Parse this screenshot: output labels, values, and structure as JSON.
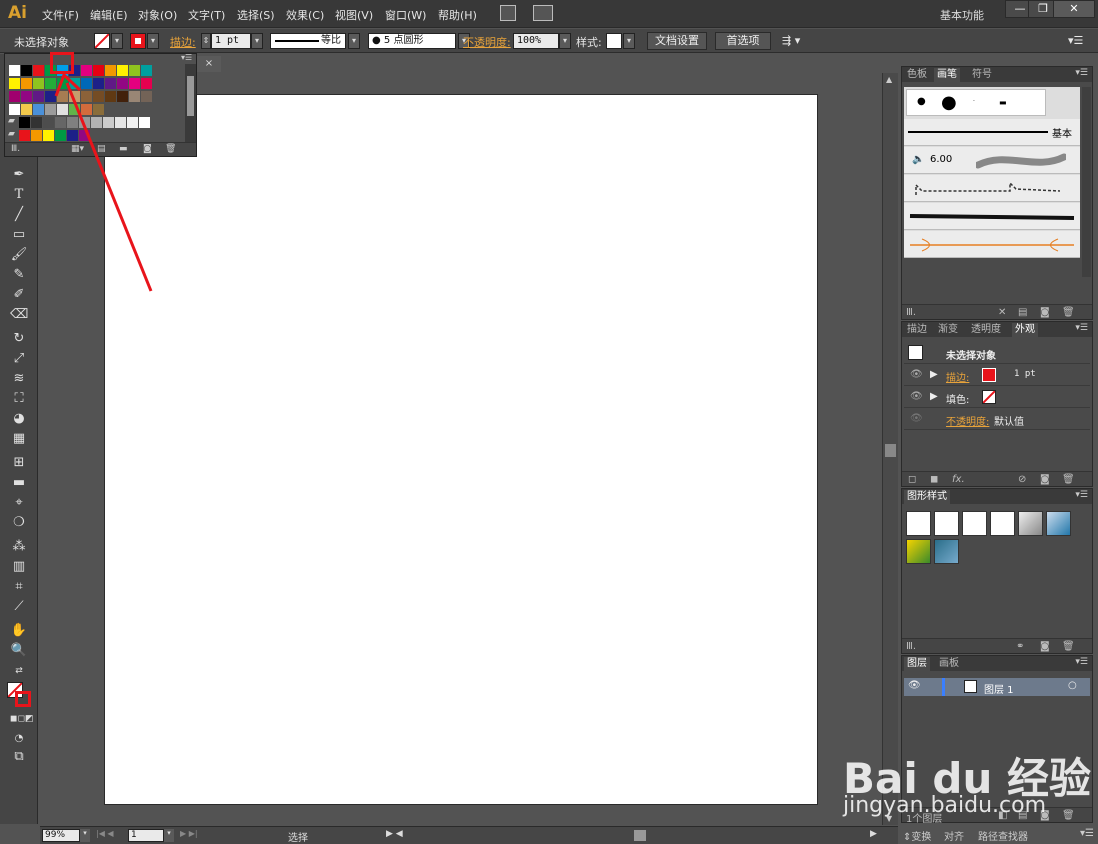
{
  "app": {
    "logo": "Ai"
  },
  "menu": [
    "文件(F)",
    "编辑(E)",
    "对象(O)",
    "文字(T)",
    "选择(S)",
    "效果(C)",
    "视图(V)",
    "窗口(W)",
    "帮助(H)"
  ],
  "workspace": "基本功能",
  "window_buttons": {
    "minimize": "—",
    "restore": "❐",
    "close": "✕"
  },
  "controlbar": {
    "selection_status": "未选择对象",
    "stroke_label": "描边:",
    "stroke_weight": "1 pt",
    "profile_label": "等比",
    "brush_label": "5 点圆形",
    "opacity_label": "不透明度:",
    "opacity_value": "100%",
    "style_label": "样式:",
    "doc_setup": "文档设置",
    "preferences": "首选项"
  },
  "doc_tab_close": "×",
  "colors": {
    "stroke_accent": "#e8141b",
    "label_orange": "#e8a33a",
    "panel_bg": "#4a4a4a",
    "canvas_bg": "#535353"
  },
  "swatches": {
    "row1": [
      "#ffffff",
      "#000000",
      "#e8141b",
      "#009a44",
      "#00a0e9",
      "#1d2088",
      "#e4007f",
      "#e60012",
      "#f39800",
      "#fff100",
      "#8fc31f",
      "#00a0a0"
    ],
    "row2": [
      "#fff100",
      "#f39800",
      "#8fc31f",
      "#22ac38",
      "#009944",
      "#00a29a",
      "#0068b7",
      "#1d2088",
      "#601986",
      "#920783",
      "#e4007f",
      "#e5004f"
    ],
    "row3": [
      "#a0006e",
      "#920783",
      "#601986",
      "#1d2088",
      "#a67c52",
      "#c69c6d",
      "#8c6239",
      "#754c24",
      "#603913",
      "#42210b",
      "#998675",
      "#736357"
    ],
    "row4": [
      "#ffffff",
      "#f2c94c",
      "#4a90d9",
      "#9b9b9b",
      "#e0e0e0",
      "#62b34a",
      "#d36b3c",
      "#8a6d3b"
    ],
    "row5": [
      "#000000",
      "#333333",
      "#4d4d4d",
      "#666666",
      "#808080",
      "#999999",
      "#b3b3b3",
      "#cccccc",
      "#e6e6e6",
      "#f2f2f2",
      "#ffffff"
    ],
    "row6": [
      "#e8141b",
      "#f39800",
      "#fff100",
      "#009944",
      "#1d2088",
      "#920783"
    ]
  },
  "panel_brushes": {
    "tabs": [
      "色板",
      "画笔",
      "符号"
    ],
    "basic_label": "基本",
    "size_value": "6.00"
  },
  "panel_appearance": {
    "tabs": [
      "描边",
      "渐变",
      "透明度",
      "外观"
    ],
    "title": "未选择对象",
    "stroke_label": "描边:",
    "stroke_value": "1 pt",
    "fill_label": "填色:",
    "opacity_label": "不透明度:",
    "opacity_value": "默认值",
    "fx": "fx."
  },
  "panel_graphic_styles": {
    "tabs": [
      "图形样式"
    ]
  },
  "panel_layers": {
    "tabs": [
      "图层",
      "画板"
    ],
    "layer_name": "图层 1",
    "footer_label": "1个图层"
  },
  "status": {
    "zoom": "99%",
    "page": "1",
    "mode": "选择"
  },
  "bottom_tabs": [
    "变换",
    "对齐",
    "路径查找器"
  ],
  "watermark": {
    "logo": "Bai du 经验",
    "text": "jingyan.baidu.com"
  }
}
